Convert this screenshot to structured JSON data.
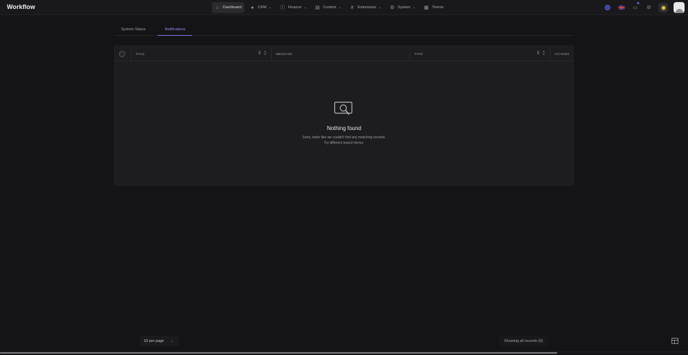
{
  "app": {
    "title": "Workflow"
  },
  "nav": {
    "items": [
      {
        "label": "Dashboard",
        "icon": "home-icon",
        "active": true
      },
      {
        "label": "CRM",
        "icon": "user-icon"
      },
      {
        "label": "Finance",
        "icon": "finance-icon"
      },
      {
        "label": "Content",
        "icon": "content-icon"
      },
      {
        "label": "Extensions",
        "icon": "grid-icon"
      },
      {
        "label": "System",
        "icon": "gear-icon"
      },
      {
        "label": "Theme",
        "icon": "theme-icon"
      }
    ]
  },
  "tabs": [
    {
      "label": "System Status",
      "active": false
    },
    {
      "label": "Notifications",
      "active": true
    }
  ],
  "table": {
    "columns": [
      "TITLE",
      "MESSAGE",
      "TYPE",
      "ACTIONS"
    ],
    "empty": {
      "title": "Nothing found",
      "line1": "Sorry, looks like we couldn't find any matching records.",
      "line2": "Try different search terms."
    }
  },
  "footer": {
    "per_page": "10 per page",
    "records": "Showing all records (0)"
  },
  "colors": {
    "background": "#141416",
    "accent": "#7a7ae6",
    "card": "#1d1d20"
  }
}
